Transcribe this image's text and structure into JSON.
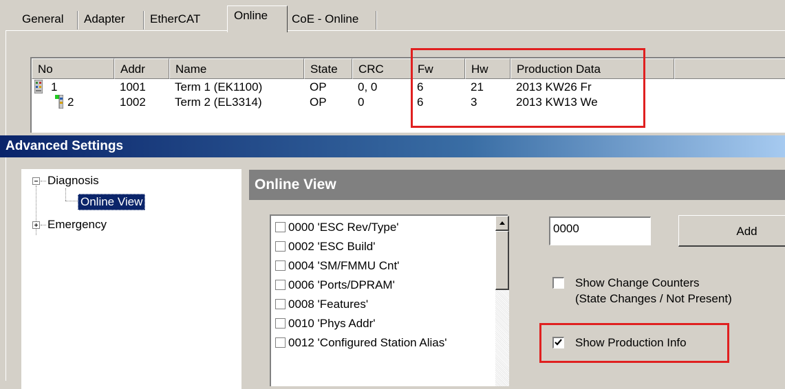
{
  "tabs": [
    "General",
    "Adapter",
    "EtherCAT",
    "Online",
    "CoE - Online"
  ],
  "active_tab": "Online",
  "device_list": {
    "columns": [
      "No",
      "Addr",
      "Name",
      "State",
      "CRC",
      "Fw",
      "Hw",
      "Production Data"
    ],
    "rows": [
      {
        "no": "1",
        "addr": "1001",
        "name": "Term 1 (EK1100)",
        "state": "OP",
        "crc": "0, 0",
        "fw": "6",
        "hw": "21",
        "prod": "2013 KW26 Fr"
      },
      {
        "no": "2",
        "addr": "1002",
        "name": "Term 2 (EL3314)",
        "state": "OP",
        "crc": "0",
        "fw": "6",
        "hw": "3",
        "prod": "2013 KW13 We"
      }
    ]
  },
  "advanced": {
    "title": "Advanced Settings",
    "tree": {
      "diagnosis": "Diagnosis",
      "online_view": "Online View",
      "emergency": "Emergency"
    },
    "section_title": "Online View",
    "registers": [
      "0000 'ESC Rev/Type'",
      "0002 'ESC Build'",
      "0004 'SM/FMMU Cnt'",
      "0006 'Ports/DPRAM'",
      "0008 'Features'",
      "0010 'Phys Addr'",
      "0012 'Configured Station Alias'"
    ],
    "address_value": "0000",
    "add_label": "Add",
    "show_change_counters": {
      "line1": "Show Change Counters",
      "line2": "(State Changes / Not Present)",
      "checked": false
    },
    "show_production_info": {
      "label": "Show Production Info",
      "checked": true
    }
  },
  "colors": {
    "highlight": "#e02020",
    "title_gradient_start": "#0a246a",
    "title_gradient_end": "#a6caf0"
  }
}
